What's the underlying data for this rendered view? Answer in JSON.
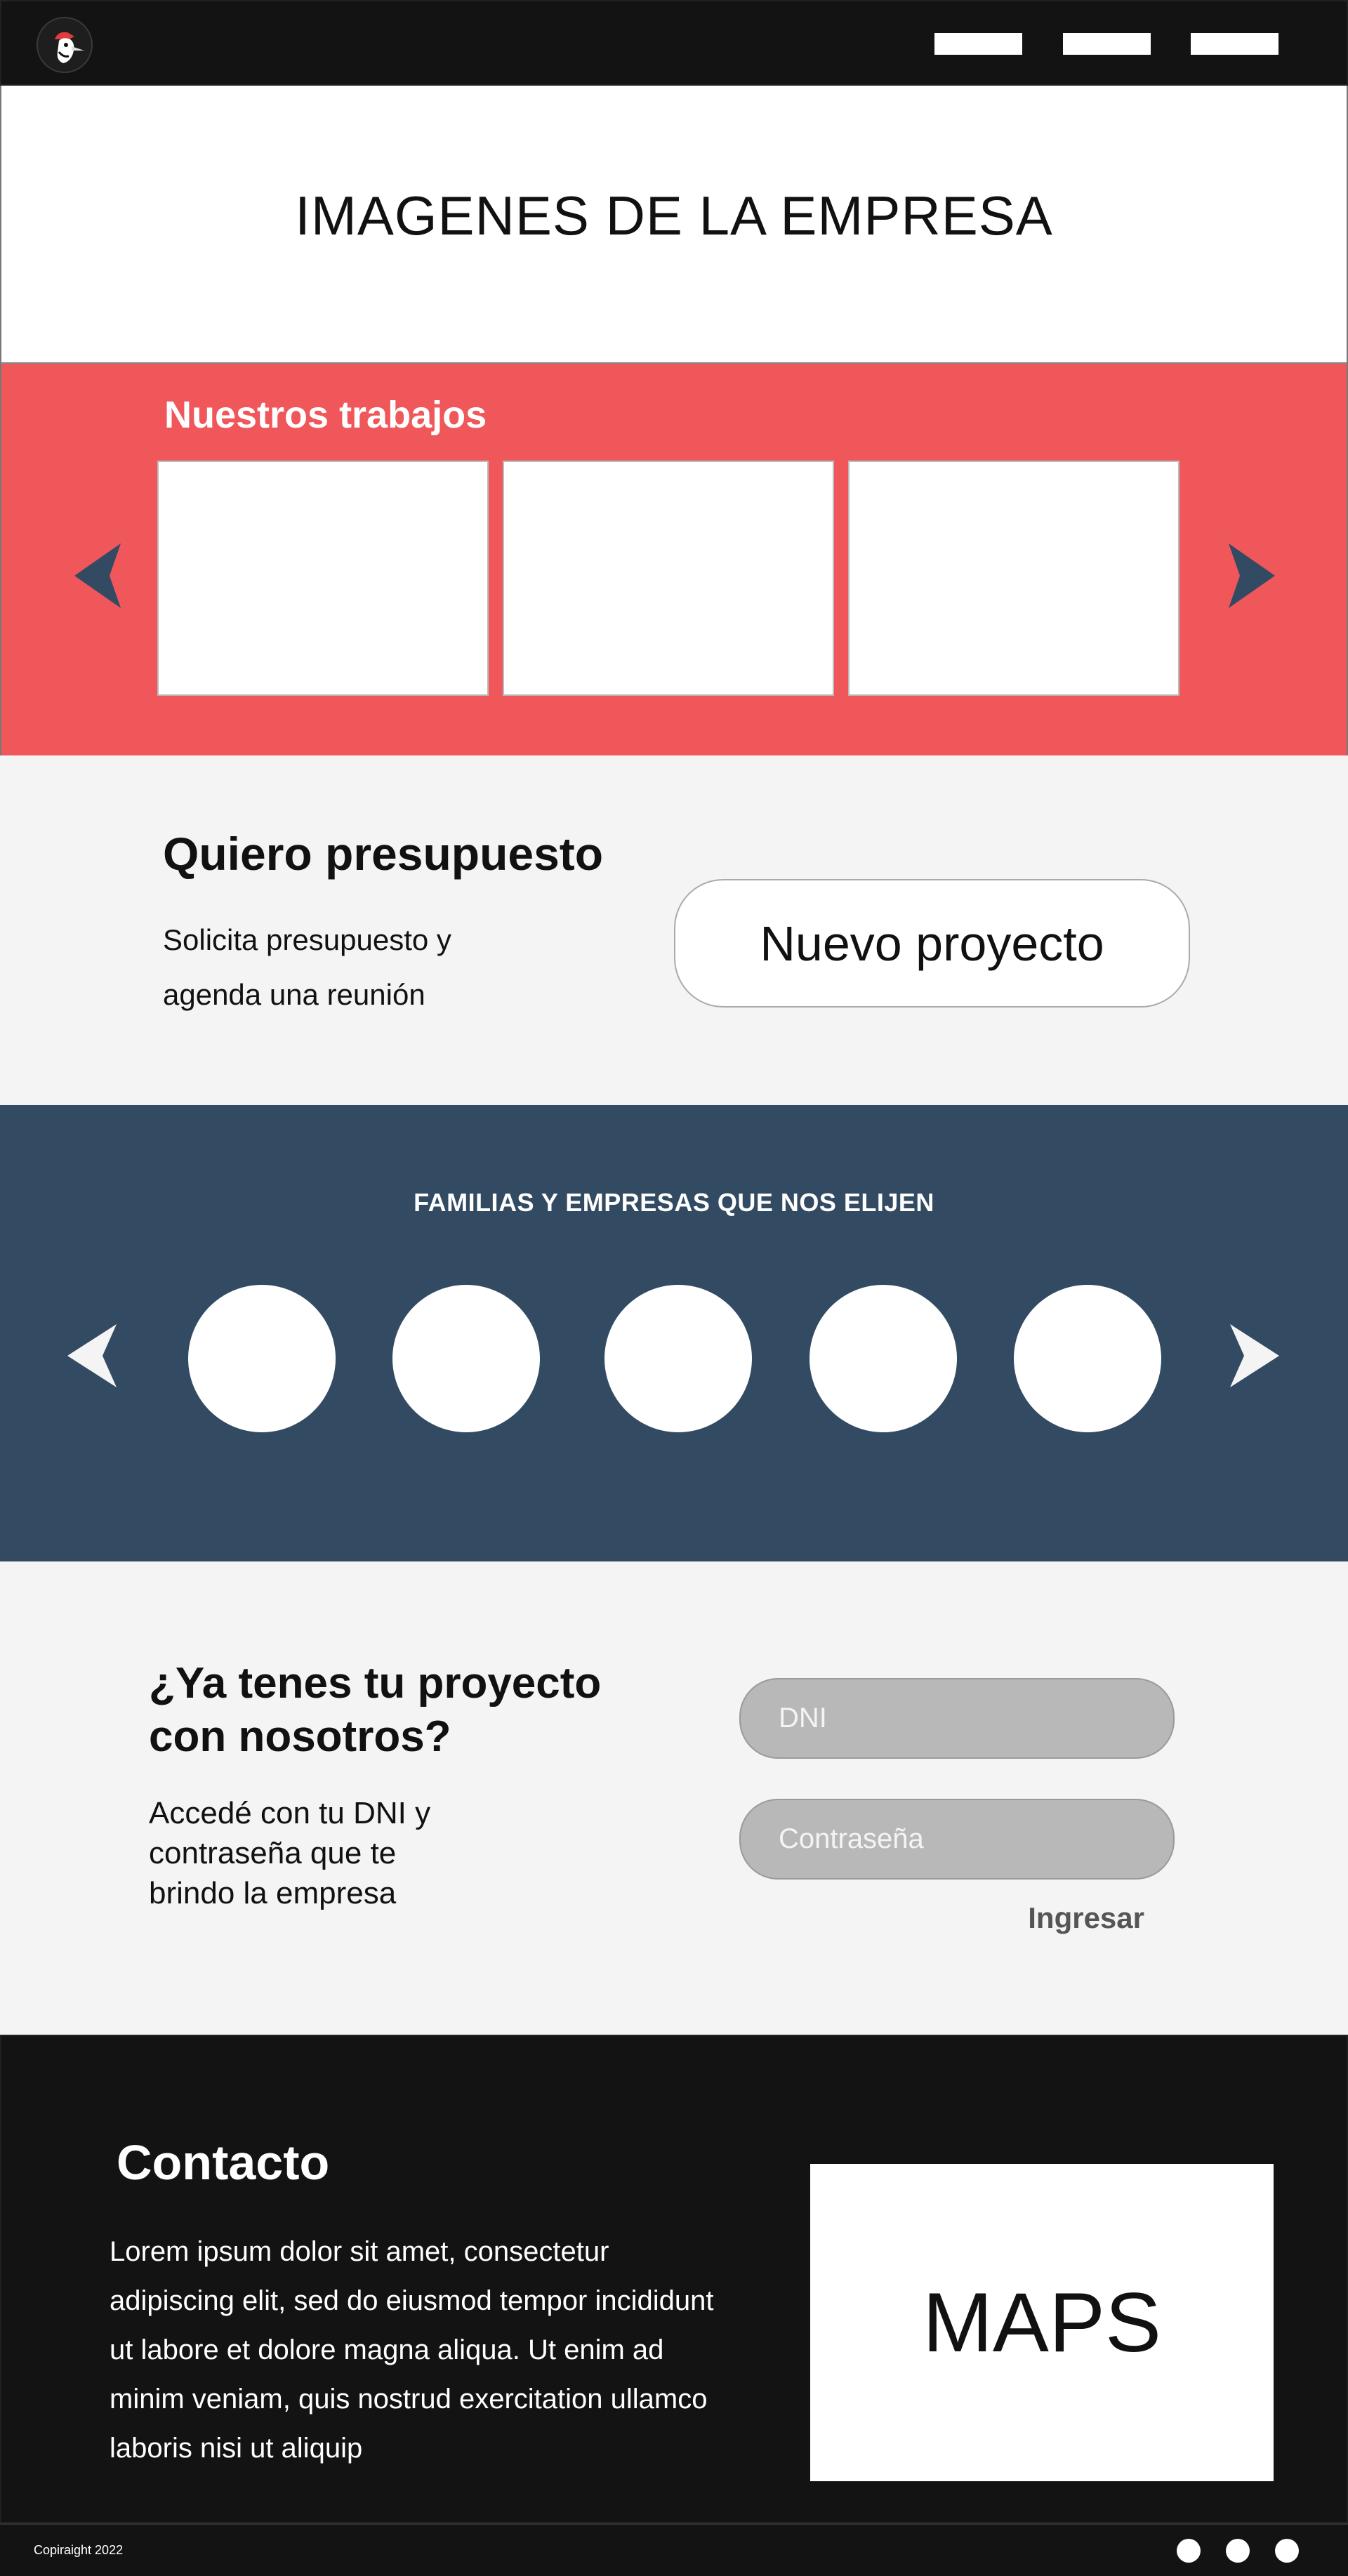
{
  "header": {
    "logo_icon": "woodpecker-logo-icon",
    "nav_items": [
      "",
      "",
      ""
    ]
  },
  "hero": {
    "title": "IMAGENES DE LA EMPRESA"
  },
  "works": {
    "title": "Nuestros trabajos",
    "prev_icon": "chevron-left-icon",
    "next_icon": "chevron-right-icon",
    "cards": [
      "",
      "",
      ""
    ],
    "accent_color": "#ef575b"
  },
  "quote": {
    "title": "Quiero presupuesto",
    "text": "Solicita presupuesto y agenda una reunión",
    "button_label": "Nuevo proyecto"
  },
  "clients": {
    "title": "FAMILIAS Y EMPRESAS QUE NOS ELIJEN",
    "prev_icon": "chevron-left-icon",
    "next_icon": "chevron-right-icon",
    "logos": [
      "",
      "",
      "",
      "",
      ""
    ],
    "background_color": "#334a63"
  },
  "login": {
    "title": "¿Ya tenes tu proyecto con nosotros?",
    "text": "Accedé con tu DNI y contraseña que te brindo la empresa",
    "dni_placeholder": "DNI",
    "password_placeholder": "Contraseña",
    "submit_label": "Ingresar"
  },
  "contact": {
    "title": "Contacto",
    "text": "Lorem ipsum dolor sit amet, consectetur adipiscing elit, sed do eiusmod tempor incididunt ut labore et dolore magna aliqua. Ut enim ad minim veniam, quis nostrud exercitation  ullamco laboris nisi ut aliquip",
    "map_label": "MAPS"
  },
  "footer": {
    "copyright": "Copiraight 2022",
    "social_icons": [
      "social-icon-1",
      "social-icon-2",
      "social-icon-3"
    ]
  }
}
